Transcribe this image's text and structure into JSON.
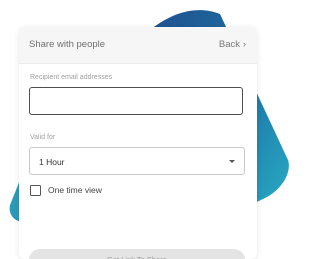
{
  "dialog": {
    "title": "Share with people",
    "back_label": "Back",
    "back_icon": "chevron-right-icon"
  },
  "recipients": {
    "label": "Recipient email addresses",
    "value": "",
    "placeholder": ""
  },
  "validity": {
    "label": "Valid for",
    "selected": "1 Hour",
    "caret_icon": "caret-down-icon"
  },
  "one_time_view": {
    "label": "One time view",
    "checked": false
  },
  "cta": {
    "label": "Get Link To Share",
    "enabled": false
  },
  "colors": {
    "shape_teal": "#2a9fb8",
    "shape_deep": "#1f4f8e",
    "header_bg": "#f6f6f6"
  }
}
